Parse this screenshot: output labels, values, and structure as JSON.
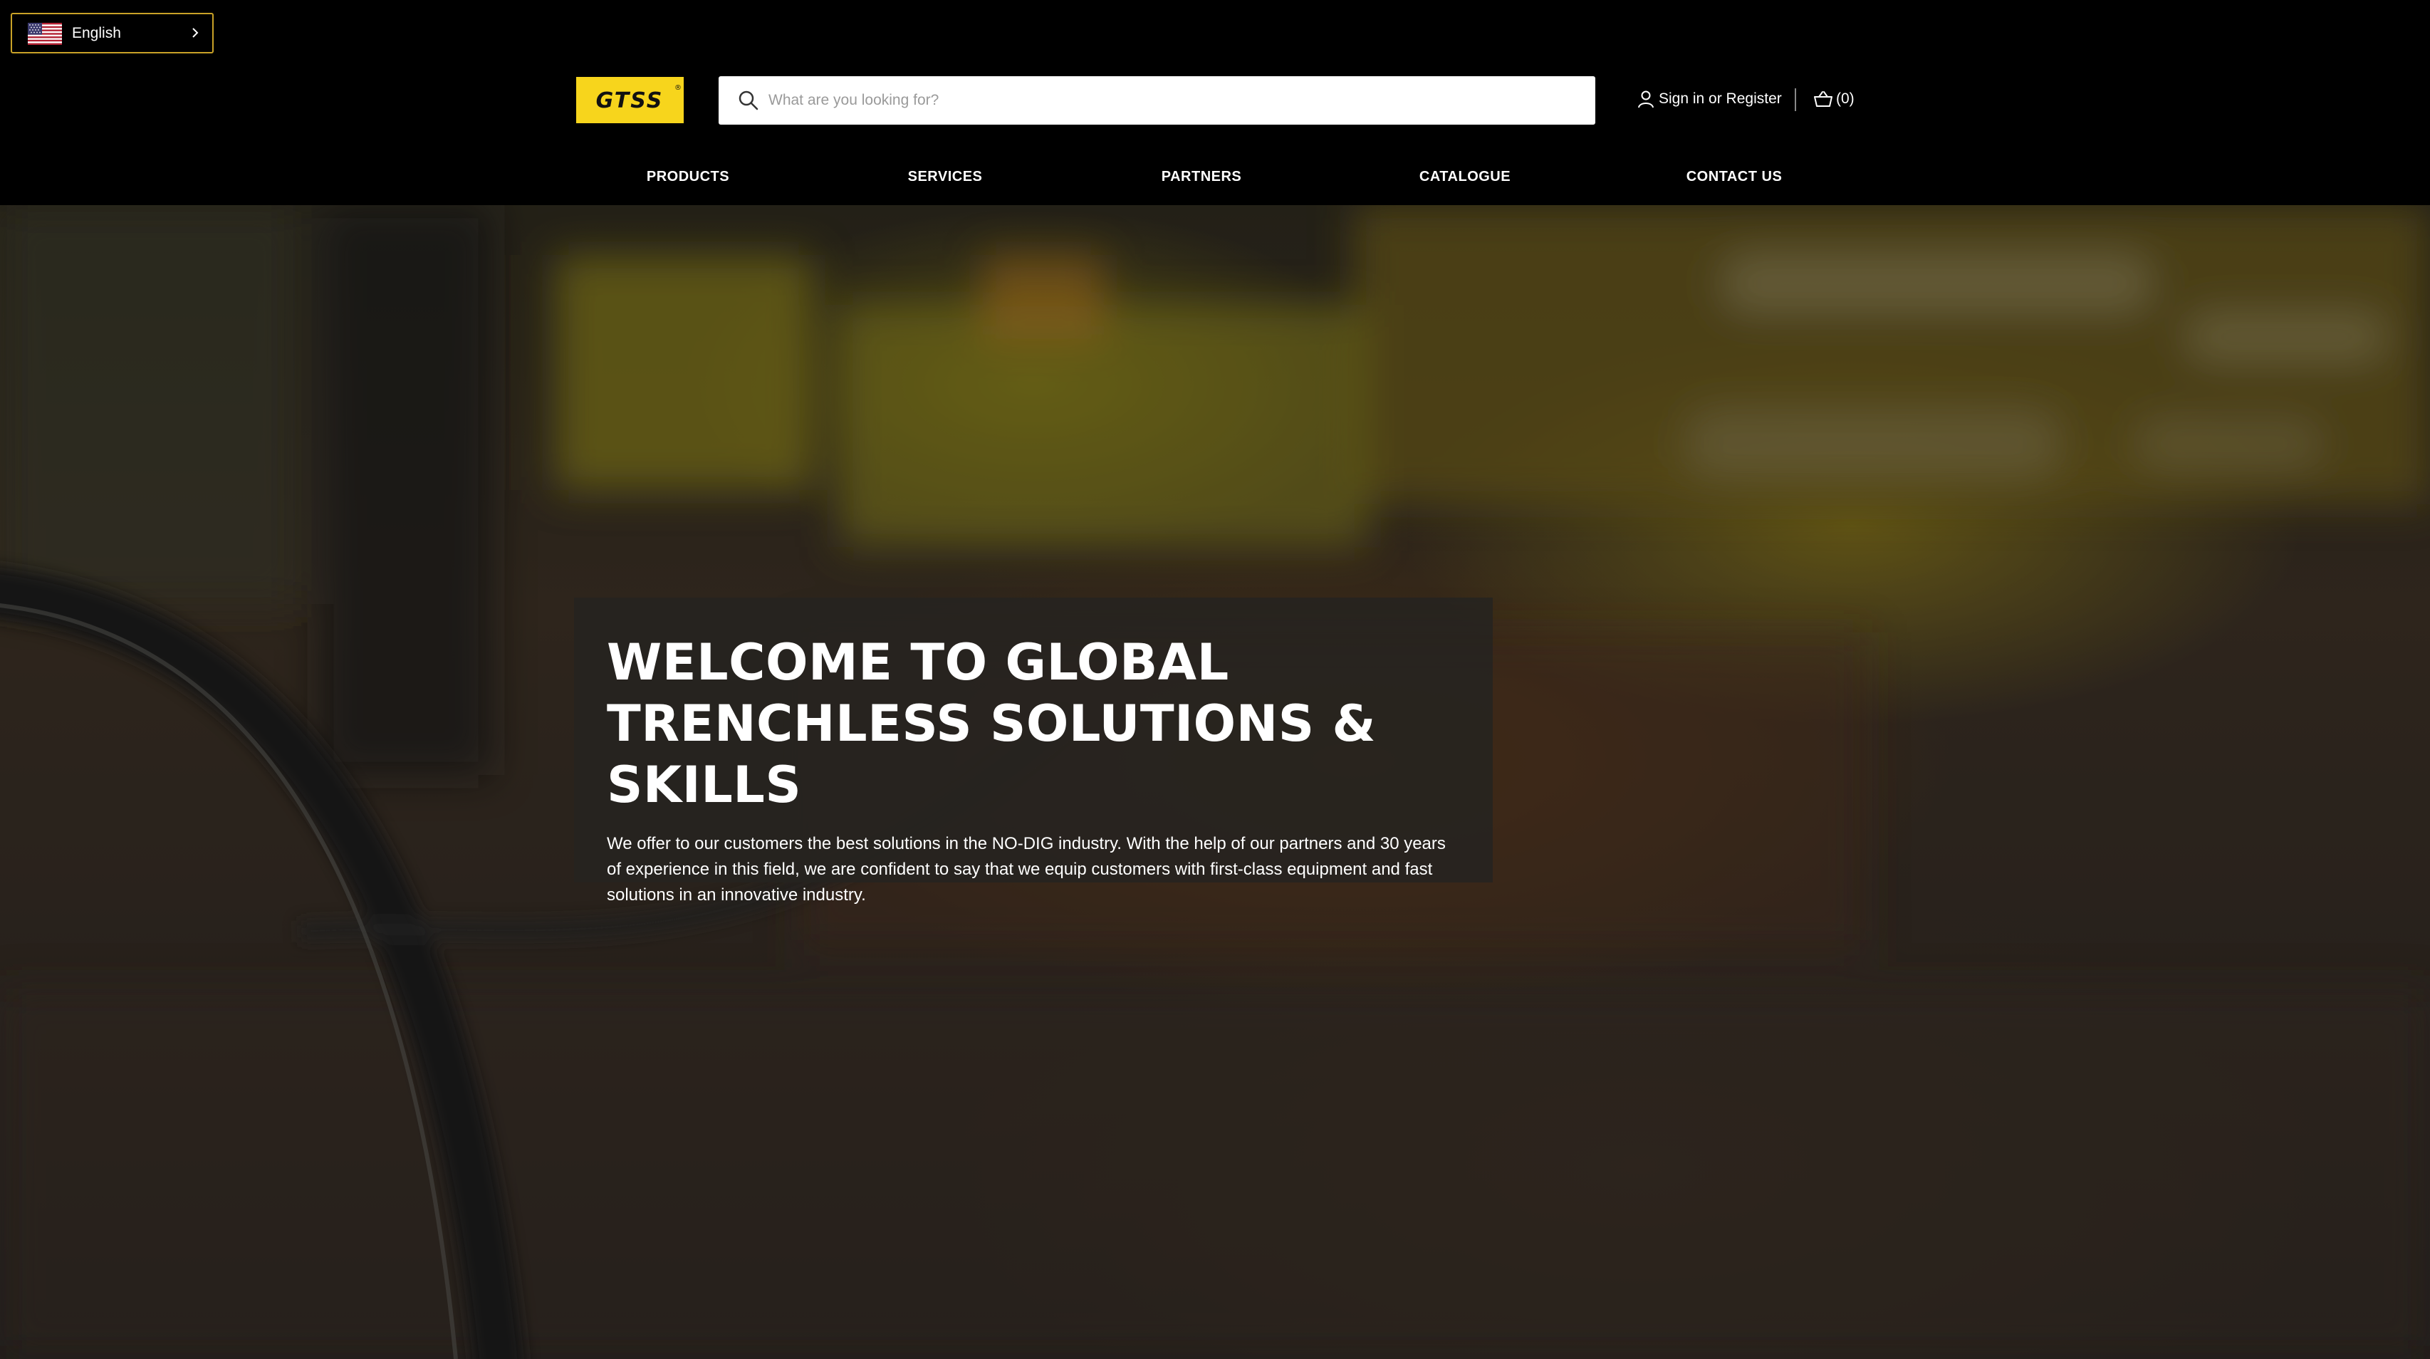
{
  "language_selector": {
    "label": "English",
    "flag_icon": "us-flag-icon",
    "chevron_icon": "chevron-right-icon"
  },
  "logo": {
    "text": "GTSS",
    "mark": "®",
    "background": "#f7d51c"
  },
  "search": {
    "placeholder": "What are you looking for?",
    "value": "",
    "icon": "search-icon"
  },
  "account": {
    "icon": "user-icon",
    "label": "Sign in or Register"
  },
  "cart": {
    "icon": "basket-icon",
    "count_label": "(0)"
  },
  "nav": {
    "items": [
      {
        "label": "PRODUCTS"
      },
      {
        "label": "SERVICES"
      },
      {
        "label": "PARTNERS"
      },
      {
        "label": "CATALOGUE"
      },
      {
        "label": "CONTACT US"
      }
    ]
  },
  "hero": {
    "title": "WELCOME TO GLOBAL TRENCHLESS SOLUTIONS & SKILLS",
    "text": "We offer to our customers the best solutions in the NO-DIG industry. With the help of our partners and 30 years of experience in this field, we are confident to say that we equip customers with first-class equipment and fast solutions in an innovative industry."
  },
  "colors": {
    "header_bg": "#000000",
    "accent_yellow": "#f7d51c",
    "lang_border": "#c9a227",
    "text": "#ffffff"
  }
}
